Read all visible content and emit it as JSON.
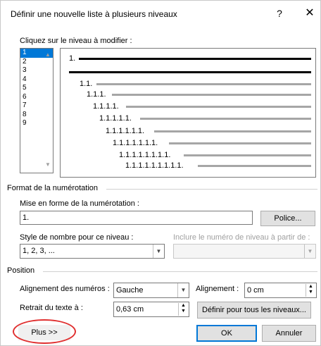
{
  "window": {
    "title": "Définir une nouvelle liste à plusieurs niveaux",
    "help": "?",
    "close": "✕"
  },
  "levels": {
    "label": "Cliquez sur le niveau à modifier :",
    "items": [
      "1",
      "2",
      "3",
      "4",
      "5",
      "6",
      "7",
      "8",
      "9"
    ],
    "selected": "1"
  },
  "preview": {
    "rows": [
      "1.",
      "",
      "1.1.",
      "1.1.1.",
      "1.1.1.1.",
      "1.1.1.1.1.",
      "1.1.1.1.1.1.",
      "1.1.1.1.1.1.1.",
      "1.1.1.1.1.1.1.1.",
      "1.1.1.1.1.1.1.1.1."
    ]
  },
  "format": {
    "section": "Format de la numérotation",
    "mise_label": "Mise en forme de la numérotation :",
    "mise_value": "1.",
    "police": "Police...",
    "style_label": "Style de nombre pour ce niveau :",
    "style_value": "1, 2, 3, ...",
    "inclure_label": "Inclure le numéro de niveau à partir de :",
    "inclure_value": ""
  },
  "position": {
    "section": "Position",
    "align_label": "Alignement des numéros :",
    "align_value": "Gauche",
    "alignement_label": "Alignement :",
    "alignement_value": "0 cm",
    "retrait_label": "Retrait du texte à :",
    "retrait_value": "0,63 cm",
    "definir": "Définir pour tous les niveaux..."
  },
  "footer": {
    "plus": "Plus >>",
    "ok": "OK",
    "cancel": "Annuler"
  },
  "colors": {
    "accent": "#0078d7",
    "highlight": "#e03030"
  }
}
